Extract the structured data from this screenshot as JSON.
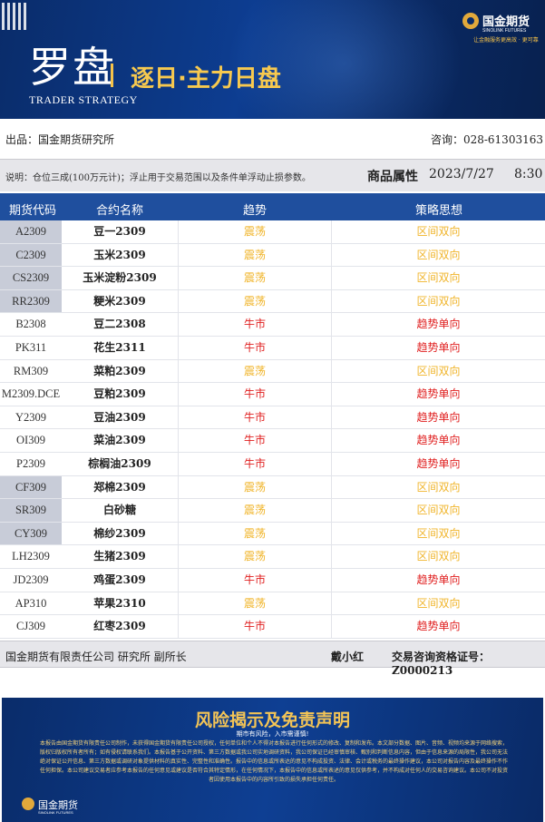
{
  "header": {
    "title_main": "罗盘",
    "title_sub": "逐日·主力日盘",
    "title_en": "TRADER STRATEGY",
    "brand_cn": "国金期货",
    "brand_en": "SINOLINK FUTURES",
    "brand_slogan": "让金融服务更高效 · 更可靠"
  },
  "source": {
    "label": "出品：国金期货研究所",
    "contact": "咨询：028-61303163"
  },
  "note": {
    "text": "说明：仓位三成(100万元计)；浮止用于交易范围以及条件单浮动止损参数。",
    "attribute": "商品属性",
    "date": "2023/7/27",
    "time": "8:30"
  },
  "table": {
    "headers": [
      "期货代码",
      "合约名称",
      "趋势",
      "策略思想"
    ],
    "rows": [
      {
        "code": "A2309",
        "name": "豆一2309",
        "trend": "震荡",
        "strategy": "区间双向"
      },
      {
        "code": "C2309",
        "name": "玉米2309",
        "trend": "震荡",
        "strategy": "区间双向"
      },
      {
        "code": "CS2309",
        "name": "玉米淀粉2309",
        "trend": "震荡",
        "strategy": "区间双向"
      },
      {
        "code": "RR2309",
        "name": "粳米2309",
        "trend": "震荡",
        "strategy": "区间双向"
      },
      {
        "code": "B2308",
        "name": "豆二2308",
        "trend": "牛市",
        "strategy": "趋势单向"
      },
      {
        "code": "PK311",
        "name": "花生2311",
        "trend": "牛市",
        "strategy": "趋势单向"
      },
      {
        "code": "RM309",
        "name": "菜粕2309",
        "trend": "震荡",
        "strategy": "区间双向"
      },
      {
        "code": "M2309.DCE",
        "name": "豆粕2309",
        "trend": "牛市",
        "strategy": "趋势单向"
      },
      {
        "code": "Y2309",
        "name": "豆油2309",
        "trend": "牛市",
        "strategy": "趋势单向"
      },
      {
        "code": "OI309",
        "name": "菜油2309",
        "trend": "牛市",
        "strategy": "趋势单向"
      },
      {
        "code": "P2309",
        "name": "棕榈油2309",
        "trend": "牛市",
        "strategy": "趋势单向"
      },
      {
        "code": "CF309",
        "name": "郑棉2309",
        "trend": "震荡",
        "strategy": "区间双向"
      },
      {
        "code": "SR309",
        "name": "白砂糖",
        "trend": "震荡",
        "strategy": "区间双向"
      },
      {
        "code": "CY309",
        "name": "棉纱2309",
        "trend": "震荡",
        "strategy": "区间双向"
      },
      {
        "code": "LH2309",
        "name": "生猪2309",
        "trend": "震荡",
        "strategy": "区间双向"
      },
      {
        "code": "JD2309",
        "name": "鸡蛋2309",
        "trend": "牛市",
        "strategy": "趋势单向"
      },
      {
        "code": "AP310",
        "name": "苹果2310",
        "trend": "震荡",
        "strategy": "区间双向"
      },
      {
        "code": "CJ309",
        "name": "红枣2309",
        "trend": "牛市",
        "strategy": "趋势单向"
      }
    ]
  },
  "footer": {
    "company": "国金期货有限责任公司 研究所 副所长",
    "person": "戴小红",
    "license": "交易咨询资格证号：Z0000213"
  },
  "disclaimer": {
    "title": "风险揭示及免责声明",
    "subtitle": "期市有风险，入市需谨慎!",
    "body": "本报告由国金期货有限责任公司制作，未获得国金期货有限责任公司授权，任何单位和个人不得对本报告进行任何形式的修改、复制和发布。本文部分数据、图片、音频、视频均来源于网络搜索，版权归版权所有者所有；如有侵权请联系我们。本报告基于公开资料、第三方数据或我公司实地调研资料，我公司保证已经审慎审核、甄别和判断信息内容，但由于信息来源的局限性，我公司无法绝对保证公开信息、第三方数据或调研对象提供材料的真实性、完整性和准确性。报告中的信息或所表达的意见不构成投资、法律、会计或税务的最终操作建议，本公司对报告内容及最终操作不作任何担保。本公司建议交易者应参考本报告的任何意见或建议是否符合其特定情形，在任何情况下，本报告中的信息或所表述的意见仅供参考，并不构成对任何人的交易咨询建议。本公司不对投资者因使用本报告中的内容所引致的损失承担任何责任。",
    "logo_cn": "国金期货",
    "logo_en": "SINOLINK FUTURES"
  },
  "colors": {
    "oscillate": "#f0b429",
    "bull": "#e02020",
    "header_blue": "#1f4f9e"
  }
}
